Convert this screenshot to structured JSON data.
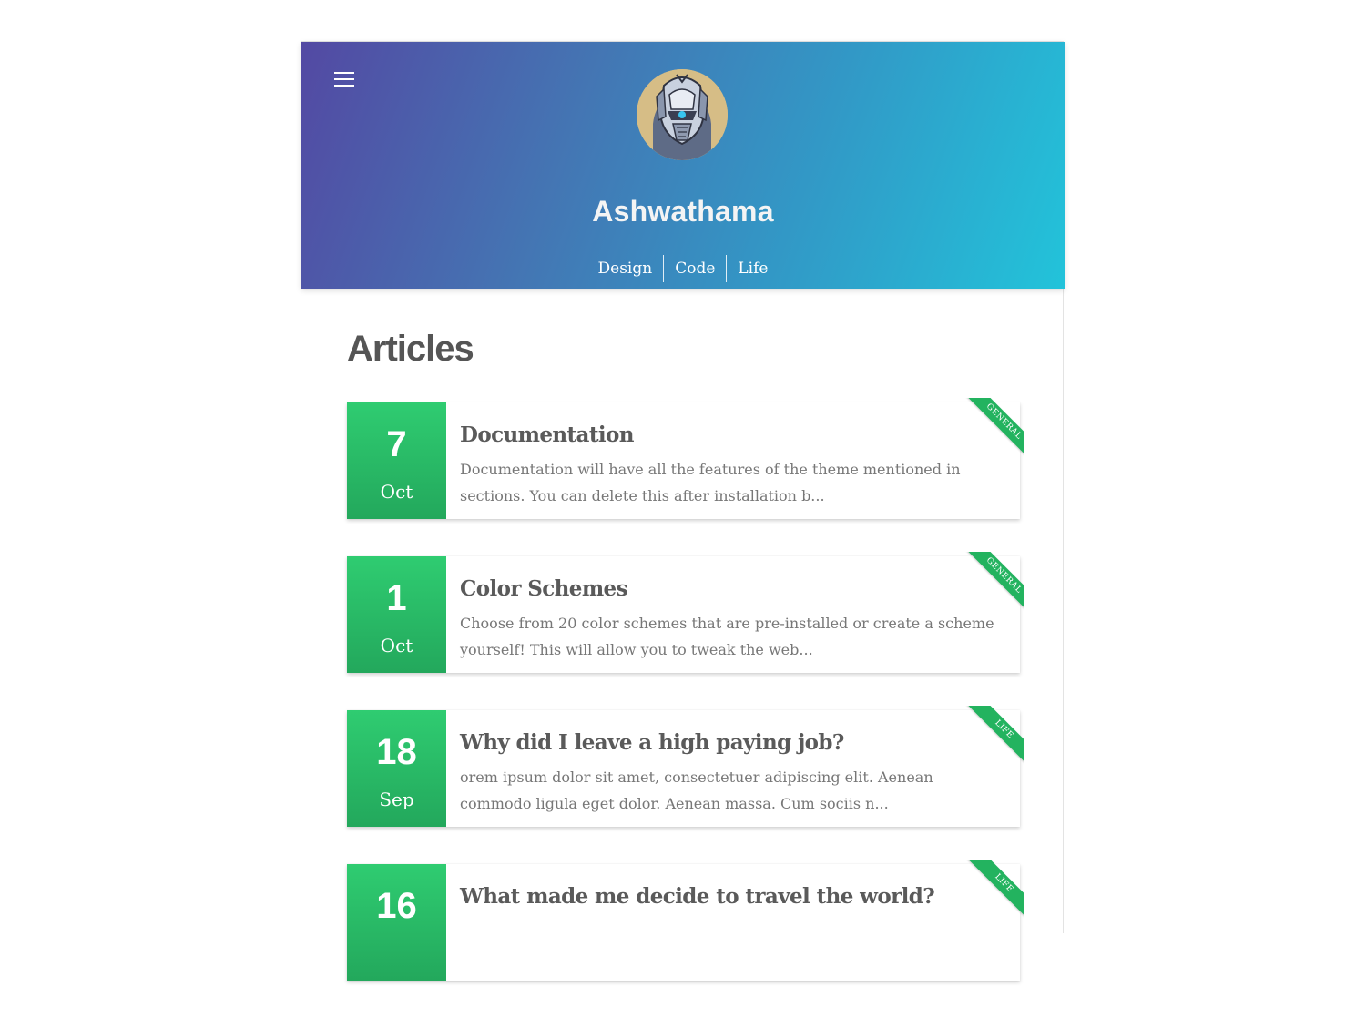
{
  "header": {
    "site_title": "Ashwathama",
    "avatar": "robot-avatar",
    "menu_icon": "hamburger-menu-icon",
    "gradient_colors": [
      "#5349a3",
      "#22c3da"
    ],
    "nav": [
      {
        "label": "Design"
      },
      {
        "label": "Code"
      },
      {
        "label": "Life"
      }
    ]
  },
  "main": {
    "section_title": "Articles",
    "accent_color": "#2ecc71",
    "articles": [
      {
        "day": "7",
        "month": "Oct",
        "title": "Documentation",
        "excerpt": "Documentation will have all the features of the theme mentioned in sections. You can delete this after installation b...",
        "category": "General"
      },
      {
        "day": "1",
        "month": "Oct",
        "title": "Color Schemes",
        "excerpt": "Choose from 20 color schemes that are pre-installed or create a scheme yourself! This will allow you to tweak the web...",
        "category": "General"
      },
      {
        "day": "18",
        "month": "Sep",
        "title": "Why did I leave a high paying job?",
        "excerpt": "orem ipsum dolor sit amet, consectetuer adipiscing elit. Aenean commodo ligula eget dolor. Aenean massa. Cum sociis n...",
        "category": "Life"
      },
      {
        "day": "16",
        "month": "",
        "title": "What made me decide to travel the world?",
        "excerpt": "",
        "category": "Life"
      }
    ]
  }
}
